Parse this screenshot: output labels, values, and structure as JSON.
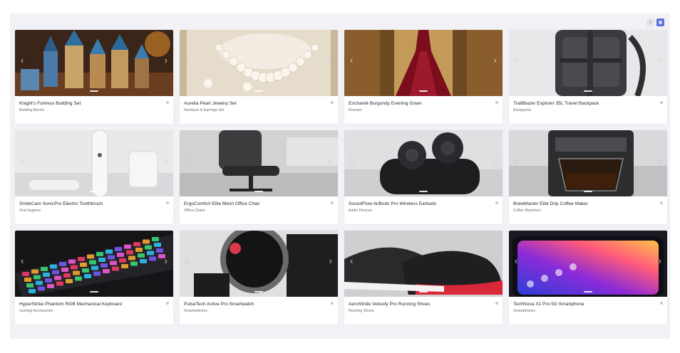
{
  "toolbar": {
    "list_view_icon": "list-icon",
    "grid_view_icon": "grid-icon",
    "list_glyph": "≡",
    "grid_glyph": "▦"
  },
  "products": [
    {
      "title": "Knight's Fortress Building Set",
      "category": "Building Blocks",
      "image": "castle"
    },
    {
      "title": "Aurelia Pearl Jewelry Set",
      "category": "Necklace & Earrings Set",
      "image": "pearls"
    },
    {
      "title": "Enchanté Burgundy Evening Gown",
      "category": "Dresses",
      "image": "gown"
    },
    {
      "title": "TrailBlazer Explorer 35L Travel Backpack",
      "category": "Backpacks",
      "image": "backpack"
    },
    {
      "title": "SmileCare SonicPro Electric Toothbrush",
      "category": "Oral Hygiene",
      "image": "toothbrush"
    },
    {
      "title": "ErgoComfort Elite Mesh Office Chair",
      "category": "Office Chairs",
      "image": "chair"
    },
    {
      "title": "SoundFlow AirBuds Pro Wireless Earbuds",
      "category": "Audio Devices",
      "image": "earbuds"
    },
    {
      "title": "BrewMaster Elite Drip Coffee Maker",
      "category": "Coffee Machines",
      "image": "coffee"
    },
    {
      "title": "HyperStrike Phantom RGB Mechanical Keyboard",
      "category": "Gaming Accessories",
      "image": "keyboard"
    },
    {
      "title": "PulseTech Active Pro Smartwatch",
      "category": "Smartwatches",
      "image": "watch"
    },
    {
      "title": "AeroStride Velocity Pro Running Shoes",
      "category": "Running Shoes",
      "image": "shoes"
    },
    {
      "title": "TechNova X1 Pro 5G Smartphone",
      "category": "Smartphones",
      "image": "phone"
    }
  ],
  "carousel": {
    "prev_glyph": "‹",
    "next_glyph": "›"
  },
  "colors": {
    "accent": "#5b6fd6",
    "panel": "#f1f1f6"
  }
}
